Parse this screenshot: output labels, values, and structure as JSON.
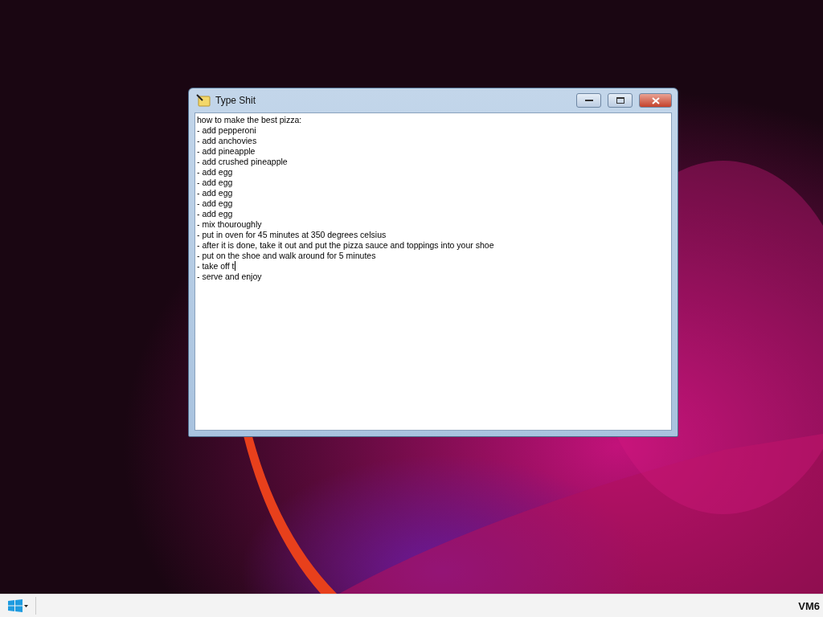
{
  "window": {
    "title": "Type Shit"
  },
  "editor": {
    "lines": [
      {
        "text": "how to make the best pizza:",
        "caret": false
      },
      {
        "text": "- add pepperoni",
        "caret": false
      },
      {
        "text": "- add anchovies",
        "caret": false
      },
      {
        "text": "- add pineapple",
        "caret": false
      },
      {
        "text": "- add crushed pineapple",
        "caret": false
      },
      {
        "text": "- add egg",
        "caret": false
      },
      {
        "text": "- add egg",
        "caret": false
      },
      {
        "text": "- add egg",
        "caret": false
      },
      {
        "text": "- add egg",
        "caret": false
      },
      {
        "text": "- add egg",
        "caret": false
      },
      {
        "text": "- mix thouroughly",
        "caret": false
      },
      {
        "text": "- put in oven for 45 minutes at 350 degrees celsius",
        "caret": false
      },
      {
        "text": "- after it is done, take it out and put the pizza sauce and toppings into your shoe",
        "caret": false
      },
      {
        "text": "- put on the shoe and walk around for 5 minutes",
        "caret": false
      },
      {
        "text": "- take off t",
        "caret": true
      },
      {
        "text": "- serve and enjoy",
        "caret": false
      }
    ]
  },
  "taskbar": {
    "label": "VM6"
  }
}
